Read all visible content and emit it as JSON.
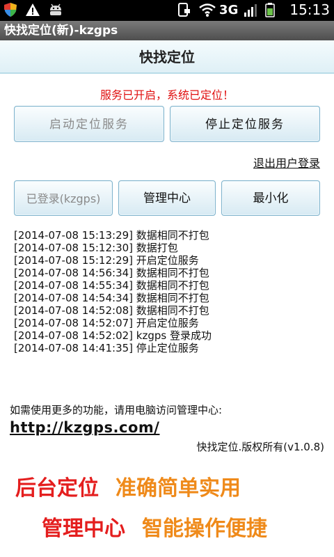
{
  "statusbar": {
    "network": "3G",
    "time": "15:13",
    "icons": [
      "shield-icon",
      "warning-icon",
      "android-icon",
      "phone-icon",
      "wifi-icon",
      "signal-icon",
      "battery-icon"
    ]
  },
  "app_title": "快找定位(新)-kzgps",
  "header_title": "快找定位",
  "status_message": "服务已开启，系统已定位！",
  "buttons": {
    "start_service": "启动定位服务",
    "stop_service": "停止定位服务",
    "logged_in": "已登录(kzgps)",
    "management": "管理中心",
    "minimize": "最小化"
  },
  "logout_link": "退出用户登录",
  "log": [
    "[2014-07-08 15:13:29] 数据相同不打包",
    "[2014-07-08 15:12:30] 数据打包",
    "[2014-07-08 15:12:29] 开启定位服务",
    "[2014-07-08 14:56:34] 数据相同不打包",
    "[2014-07-08 14:55:34] 数据相同不打包",
    "[2014-07-08 14:54:34] 数据相同不打包",
    "[2014-07-08 14:52:08] 数据相同不打包",
    "[2014-07-08 14:52:07] 开启定位服务",
    "[2014-07-08 14:52:02] kzgps 登录成功",
    "[2014-07-08 14:41:35] 停止定位服务"
  ],
  "hint_text": "如需使用更多的功能，请用电脑访问管理中心:",
  "url": "http://kzgps.com/",
  "copyright": "快找定位.版权所有(v1.0.8)",
  "promo": {
    "line1_red": "后台定位",
    "line1_orange": "准确简单实用",
    "line2_red": "管理中心",
    "line2_orange": "智能操作便捷"
  },
  "colors": {
    "status_red": "#e01010",
    "promo_red": "#e41e1e",
    "promo_orange": "#ef8a1a"
  }
}
